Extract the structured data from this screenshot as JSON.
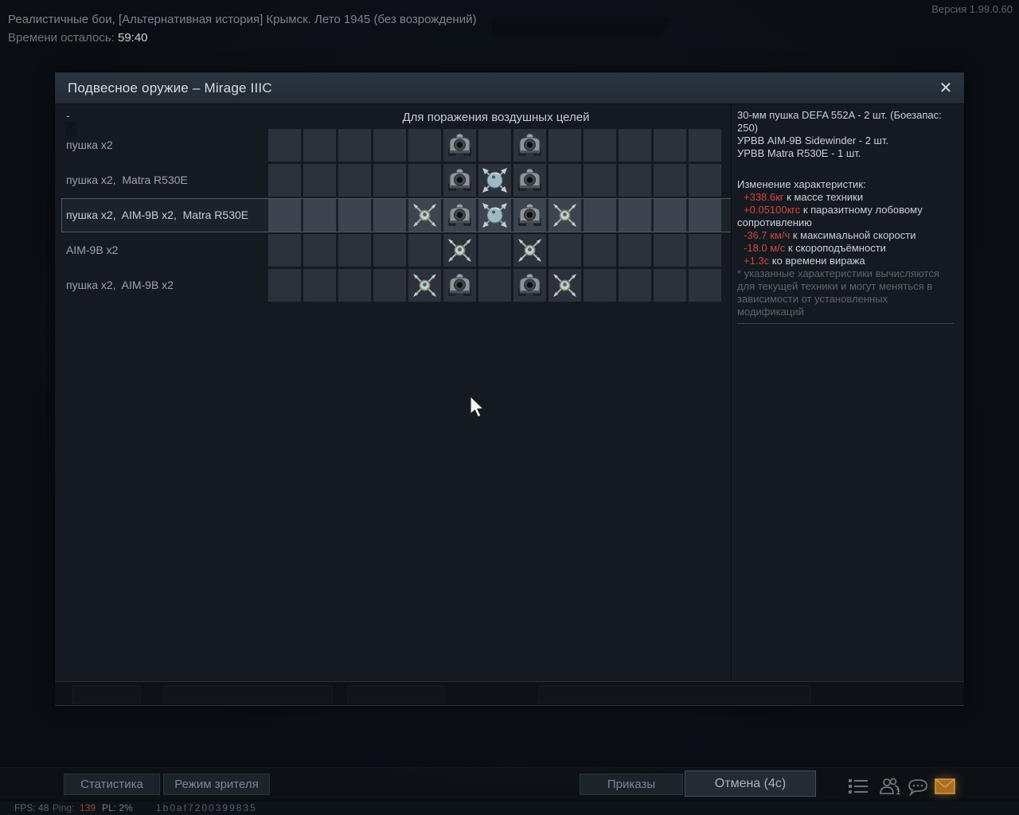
{
  "top_bar": {
    "session_title": "Реалистичные бои, [Альтернативная история] Крымск. Лето 1945 (без возрождений)",
    "time_label": "Времени осталось: ",
    "time_value": "59:40",
    "version": "Версия 1.99.0.60"
  },
  "dialog": {
    "title": "Подвесное оружие – Mirage IIIC",
    "close_icon": "✕",
    "grid_header": "Для поражения воздушных целей",
    "empty_loadout_label": "-",
    "loadouts": [
      {
        "label": "пушка x2",
        "selected": false,
        "slots": [
          {
            "col": 6,
            "icon": "gunpod-icon"
          },
          {
            "col": 8,
            "icon": "gunpod-icon"
          }
        ]
      },
      {
        "label": "пушка x2,  Matra R530E",
        "selected": false,
        "slots": [
          {
            "col": 6,
            "icon": "gunpod-icon"
          },
          {
            "col": 7,
            "icon": "r530-missile-icon"
          },
          {
            "col": 8,
            "icon": "gunpod-icon"
          }
        ]
      },
      {
        "label": "пушка x2,  AIM-9B x2,  Matra R530E",
        "selected": true,
        "slots": [
          {
            "col": 5,
            "icon": "aim9-missile-icon"
          },
          {
            "col": 6,
            "icon": "gunpod-icon"
          },
          {
            "col": 7,
            "icon": "r530-missile-icon"
          },
          {
            "col": 8,
            "icon": "gunpod-icon"
          },
          {
            "col": 9,
            "icon": "aim9-missile-icon"
          }
        ]
      },
      {
        "label": "AIM-9B x2",
        "selected": false,
        "slots": [
          {
            "col": 6,
            "icon": "aim9-missile-icon"
          },
          {
            "col": 8,
            "icon": "aim9-missile-icon"
          }
        ]
      },
      {
        "label": "пушка x2,  AIM-9B x2",
        "selected": false,
        "slots": [
          {
            "col": 5,
            "icon": "aim9-missile-icon"
          },
          {
            "col": 6,
            "icon": "gunpod-icon"
          },
          {
            "col": 8,
            "icon": "gunpod-icon"
          },
          {
            "col": 9,
            "icon": "aim9-missile-icon"
          }
        ]
      }
    ],
    "columns": 13,
    "right_panel": {
      "weapons": [
        "30-мм пушка DEFA 552A - 2 шт. (Боезапас: 250)",
        "УРВВ AIM-9B Sidewinder - 2 шт.",
        "УРВВ Matra R530E - 1 шт."
      ],
      "changes_header": "Изменение характеристик:",
      "changes": [
        {
          "value": "+338.6кг",
          "text": " к массе техники"
        },
        {
          "value": "+0.05100кгс",
          "text": " к паразитному лобовому сопротивлению"
        },
        {
          "value": "-36.7 км/ч",
          "text": " к максимальной скорости"
        },
        {
          "value": "-18.0 м/с",
          "text": " к скороподъёмности"
        },
        {
          "value": "+1.3с",
          "text": " ко времени виража"
        }
      ],
      "footnote": "* указанные характеристики вычисляются для текущей техники и могут меняться в зависимости от установленных модификаций"
    }
  },
  "bottom_bar": {
    "stats_button": "Статистика",
    "spectator_button": "Режим зрителя",
    "orders_button": "Приказы",
    "cancel_button": "Отмена (4с)",
    "icons": [
      "list-icon",
      "people-icon",
      "chat-icon",
      "mail-icon"
    ],
    "people_badge": "1"
  },
  "status_bar": {
    "fps_label": "FPS: ",
    "fps_value": "48",
    "ping_label": "Ping: ",
    "ping_value": "139",
    "pl_label": "PL: ",
    "pl_value": "2%",
    "session_id": "1b0af7200399835"
  },
  "colors": {
    "negative_stat": "#d0463e",
    "mail_accent": "#c0832f",
    "selected_border": "#4d565f"
  }
}
